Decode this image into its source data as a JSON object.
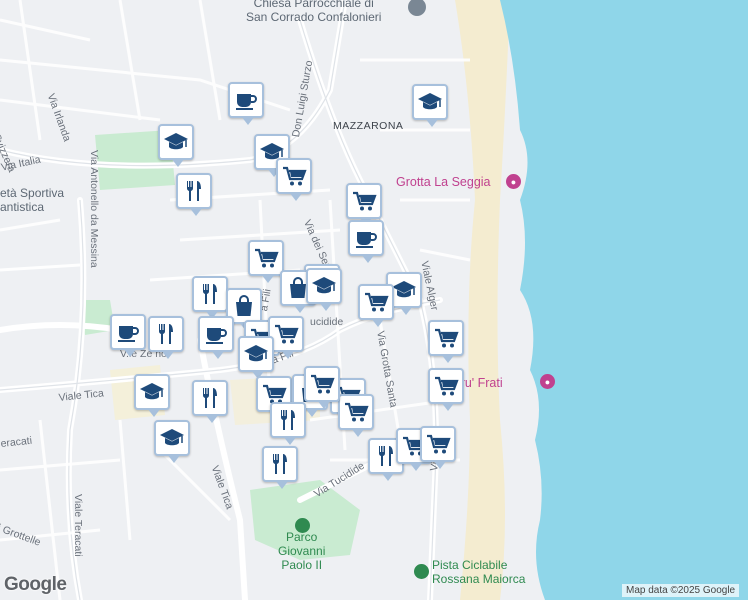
{
  "map": {
    "labels": {
      "church": [
        "Chiesa Parrocchiale di",
        "San Corrado Confalonieri"
      ],
      "mazzarona": "MAZZARONA",
      "grotta_seggia": "Grotta La Seggia",
      "sporting": [
        "età Sportiva",
        "antistica"
      ],
      "parco": [
        "Parco",
        "Giovanni",
        "Paolo II"
      ],
      "pista": [
        "Pista Ciclabile",
        "Rossana Maiorca"
      ],
      "scoglio": "S       o e ru' Frati"
    },
    "streets": {
      "svizzera": "Via Svizzera",
      "irlanda": "Via Irlanda",
      "italia": "Via Italia",
      "antonello": "Via Antonello da Messina",
      "sturzo": "Don Luigi Sturzo",
      "dei_sei": "Via dei Ser",
      "algeri": "Viale Alger",
      "tucidide_top": "ucidide",
      "grotta_santa": "Via Grotta Santa",
      "tica1": "Viale Tica",
      "tica2": "Viale Tica",
      "teracati1": "eracati",
      "teracati2": "Viale Teracati",
      "grottelle": "i Grottelle",
      "tucidide": "Via Tucidide",
      "zecchino": "V.le Ze     no",
      "filisto1": "a Fili",
      "filisto2": "ia Fili",
      "viale_bot": "Viale"
    },
    "google_logo": "Google",
    "attribution": "Map data ©2025 Google",
    "colors": {
      "sea": "#8fd6e9",
      "land": "#eef0f3",
      "park": "#c9ebd1",
      "beach": "#f4ecd0",
      "pin_icon": "#1e4a7a",
      "pin_border": "#a7c0dc",
      "poi": "#c0418f"
    }
  },
  "markers": [
    {
      "type": "cafe-icon"
    },
    {
      "type": "school-icon"
    },
    {
      "type": "school-icon"
    },
    {
      "type": "school-icon"
    },
    {
      "type": "cart-icon"
    },
    {
      "type": "restaurant-icon"
    },
    {
      "type": "cart-icon"
    },
    {
      "type": "cafe-icon"
    },
    {
      "type": "cart-icon"
    },
    {
      "type": "cart-icon"
    },
    {
      "type": "bag-icon"
    },
    {
      "type": "school-icon"
    },
    {
      "type": "school-icon"
    },
    {
      "type": "cart-icon"
    },
    {
      "type": "restaurant-icon"
    },
    {
      "type": "bag-icon"
    },
    {
      "type": "cafe-icon"
    },
    {
      "type": "restaurant-icon"
    },
    {
      "type": "cafe-icon"
    },
    {
      "type": "cart-icon"
    },
    {
      "type": "cart-icon"
    },
    {
      "type": "school-icon"
    },
    {
      "type": "cart-icon"
    },
    {
      "type": "school-icon"
    },
    {
      "type": "restaurant-icon"
    },
    {
      "type": "cart-icon"
    },
    {
      "type": "bag-icon"
    },
    {
      "type": "cart-icon"
    },
    {
      "type": "cart-icon"
    },
    {
      "type": "restaurant-icon"
    },
    {
      "type": "cart-icon"
    },
    {
      "type": "restaurant-icon"
    },
    {
      "type": "school-icon"
    },
    {
      "type": "restaurant-icon"
    },
    {
      "type": "cart-icon"
    },
    {
      "type": "cart-icon"
    },
    {
      "type": "cart-icon"
    }
  ]
}
